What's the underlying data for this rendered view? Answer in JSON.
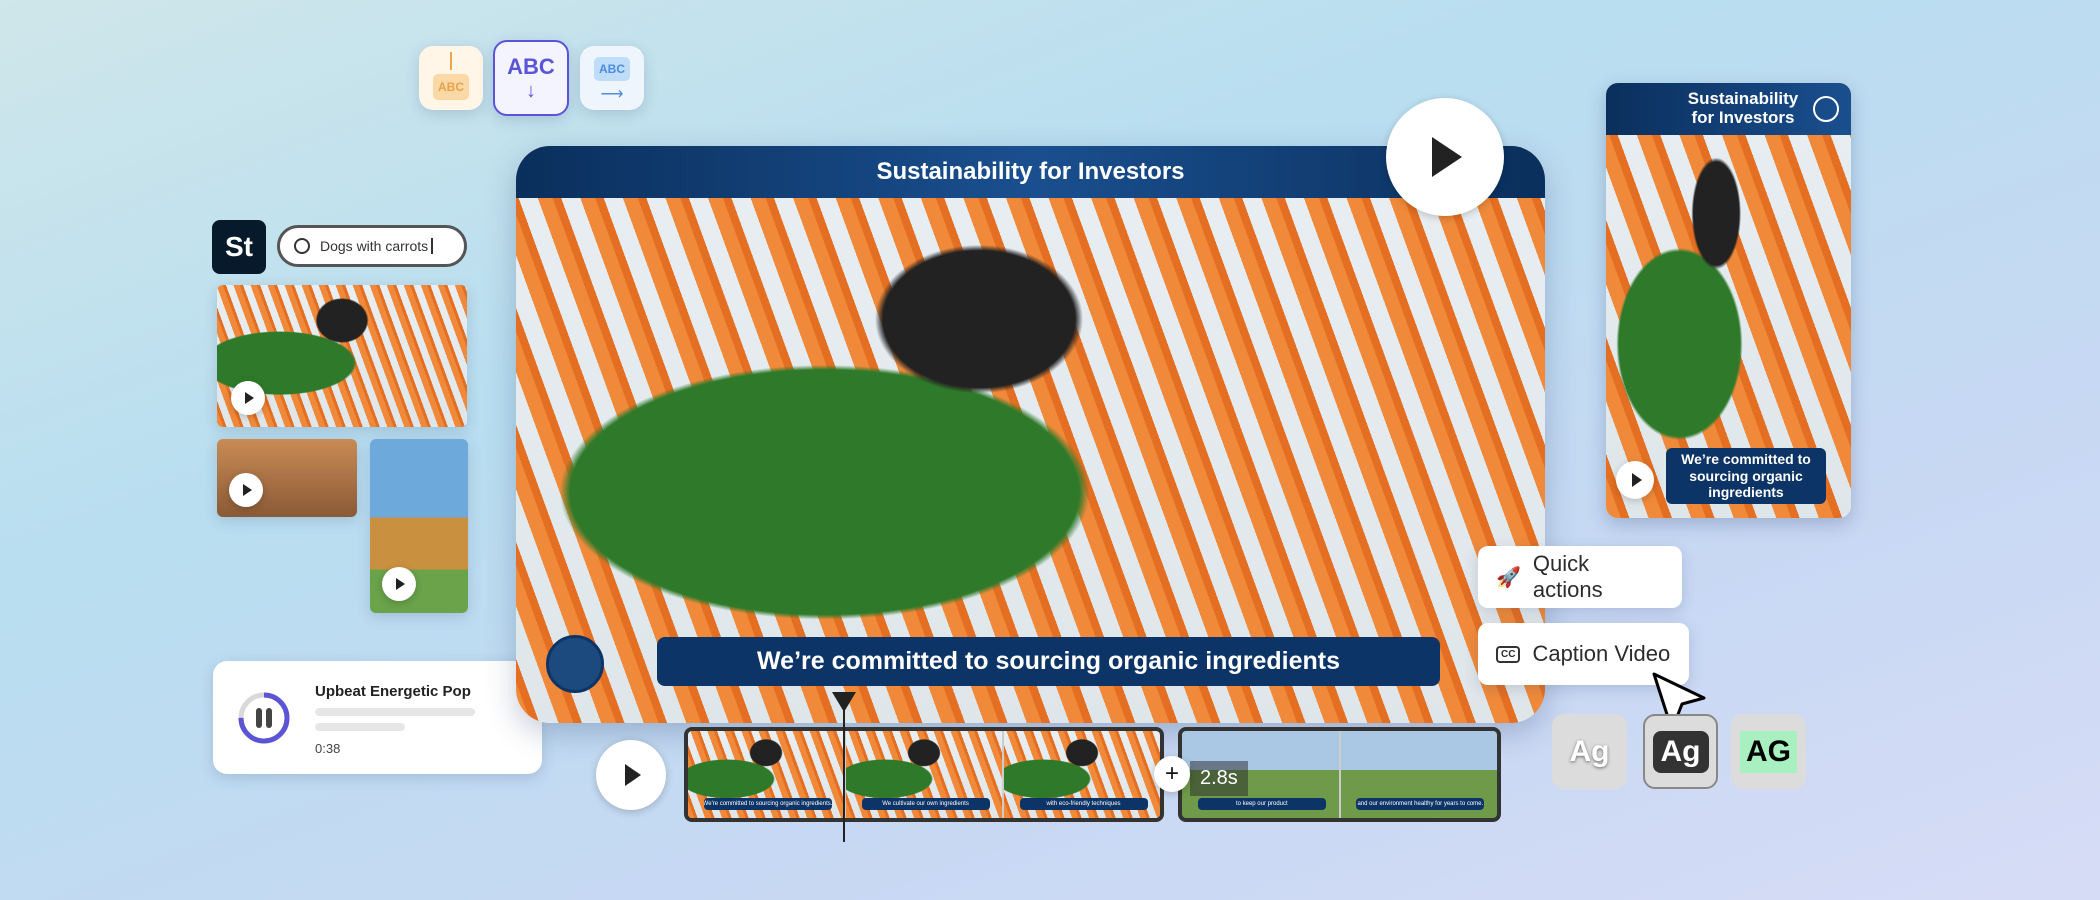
{
  "text_styles": [
    {
      "icon": "text-drop-animation-icon",
      "label": "ABC"
    },
    {
      "icon": "text-down-animation-icon",
      "label": "ABC"
    },
    {
      "icon": "text-slide-animation-icon",
      "label": "ABC"
    }
  ],
  "stock": {
    "logo": "St",
    "search_value": "Dogs with carrots"
  },
  "music": {
    "title": "Upbeat Energetic Pop",
    "time": "0:38",
    "progress": 0.75
  },
  "main_video": {
    "title": "Sustainability for Investors",
    "caption": "We’re committed to sourcing organic ingredients"
  },
  "vertical_video": {
    "title": "Sustainability for Investors",
    "caption": "We’re committed to sourcing organic ingredients"
  },
  "menu": {
    "quick_actions": "Quick actions",
    "caption_video": "Caption Video"
  },
  "caption_styles": [
    "Ag",
    "Ag",
    "AG"
  ],
  "timeline": {
    "clip1": [
      "We're committed to sourcing organic ingredients.",
      "We cultivate our own ingredients",
      "with eco-friendly techniques"
    ],
    "clip2": [
      "to keep our product",
      "and our environment healthy for years to come."
    ],
    "duration": "2.8s",
    "add": "+"
  },
  "colors": {
    "brand_blue": "#0d3466",
    "accent_purple": "#5b55d6",
    "green_highlight": "#a8f0c0"
  }
}
